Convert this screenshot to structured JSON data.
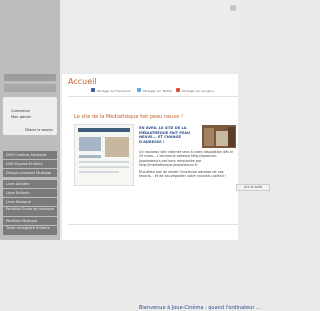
{
  "page": {
    "title": "Accueil"
  },
  "sidebar": {
    "header": "",
    "login_links": [
      "Connexion",
      "Mon panier"
    ],
    "erase_label": "Effacer la session",
    "nav_items": [
      "DVD Cinéma, Musique",
      "DVD Espace Enfants",
      "Disque compact Musique",
      "Livre Adultes",
      "Livre Enfants",
      "Livre Musique",
      "Partition École de musique",
      "Partition Musique",
      "Texte enregistré Enfants"
    ]
  },
  "social": {
    "facebook": "Partager sur Facebook",
    "twitter": "Partager sur Twitter",
    "google": "Partager sur Google+"
  },
  "post": {
    "title": "Le site de la Médiathèque fait peau neuve !",
    "headline": "EN AVRIL LE SITE DE LA MÉDIATHÈQUE FAIT PEAU NEUVE... ET CHANGE D'ADRESSE !",
    "paragraph1": "Un nouveau site internet sera à votre disposition dès le 29 mars... L'ancienne adresse http://www.bm-jouelesbours.net sera remplacée par http://mediatheque.jouelestours.fr",
    "paragraph2": "N'oubliez pas de retirer l'ancienne adresse de vos favoris... et de sauvegarder votre nouveau portail !",
    "read_more": "Lire la suite",
    "thumb_caption": "Bienvenue à la Médiathèque de Joué-lès-Tours"
  },
  "post2": {
    "title": "Bienvenue à Joue-Cinéma : quand l'ordinateur ..."
  }
}
